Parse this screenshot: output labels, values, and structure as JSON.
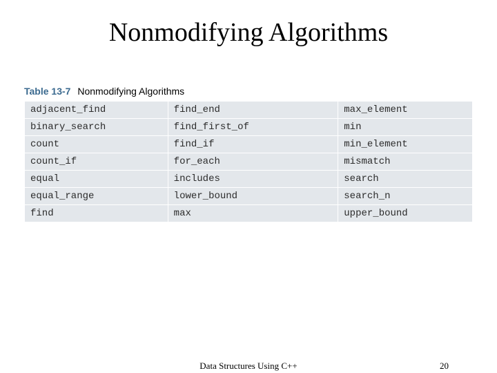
{
  "title": "Nonmodifying Algorithms",
  "table": {
    "number": "Table 13-7",
    "label": "Nonmodifying Algorithms",
    "rows": [
      [
        "adjacent_find",
        "find_end",
        "max_element"
      ],
      [
        "binary_search",
        "find_first_of",
        "min"
      ],
      [
        "count",
        "find_if",
        "min_element"
      ],
      [
        "count_if",
        "for_each",
        "mismatch"
      ],
      [
        "equal",
        "includes",
        "search"
      ],
      [
        "equal_range",
        "lower_bound",
        "search_n"
      ],
      [
        "find",
        "max",
        "upper_bound"
      ]
    ]
  },
  "footer": {
    "text": "Data Structures Using C++",
    "page": "20"
  }
}
